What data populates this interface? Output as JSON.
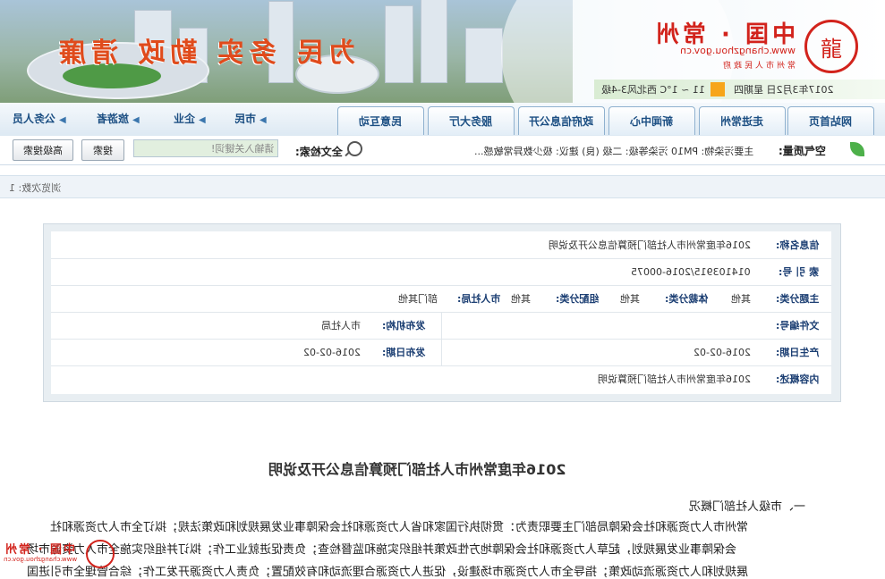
{
  "header": {
    "slogan": "为民 务实 勤政 清廉",
    "logo_cn": "中国 · 常州",
    "logo_url": "www.changzhou.gov.cn",
    "logo_sub": "常州市人民政府",
    "date": "2017年3月2日 星期四",
    "weather": "11 ~ 1°C 西北风3-4级"
  },
  "nav": {
    "roles": [
      "公务人员",
      "旅游者",
      "企业",
      "市民"
    ],
    "tabs": [
      "网站首页",
      "走进常州",
      "新闻中心",
      "政府信息公开",
      "服务大厅",
      "民意互动"
    ]
  },
  "search": {
    "label": "全文检索:",
    "placeholder": "请输入关键词!",
    "search_button": "搜索",
    "advanced_button": "高级搜索",
    "aq_label": "空气质量:",
    "aq_text": "主要污染物: PM10 污染等级: 二级 (良) 建议: 极少数异常敏感..."
  },
  "counter": "浏览次数: 1",
  "info": {
    "title_label": "信息名称:",
    "title_value": "2016年度常州市人社部门预算信息公开及说明",
    "index_label": "索 引 号:",
    "index_value": "014103915/2016-00075",
    "topic_label": "主题分类:",
    "topic_value": "其他",
    "genre_label": "体裁分类:",
    "genre_value": "其他",
    "org_label": "组配分类:",
    "org_value": "其他",
    "dept_label": "市人社局:",
    "dept_value": "部门其他",
    "doc_label": "文件编号:",
    "doc_value": "",
    "issuer_label": "发布机构:",
    "issuer_value": "市人社局",
    "created_label": "产生日期:",
    "created_value": "2016-02-02",
    "pub_label": "发布日期:",
    "pub_value": "2016-02-02",
    "summary_label": "内容概述:",
    "summary_value": "2016年度常州市人社部门预算说明"
  },
  "article": {
    "title": "2016年度常州市人社部门预算信息公开及说明",
    "section": "一、市级人社部门概况",
    "lines": [
      "常州市人力资源和社会保障局部门主要职责为：贯彻执行国家和省人力资源和社会保障事业发展规划和政策法规；拟订全市人力资源和社",
      "会保障事业发展规划，起草人力资源和社会保障地方性政策并组织实施和监督检查；负责促进就业工作；拟订并组织实施全市人力资源市场",
      "展规划和人力资源流动政策；指导全市人力资源市场建设，促进人力资源合理流动和有效配置；负责人力资源开发工作；综合管理全市引进国"
    ]
  }
}
